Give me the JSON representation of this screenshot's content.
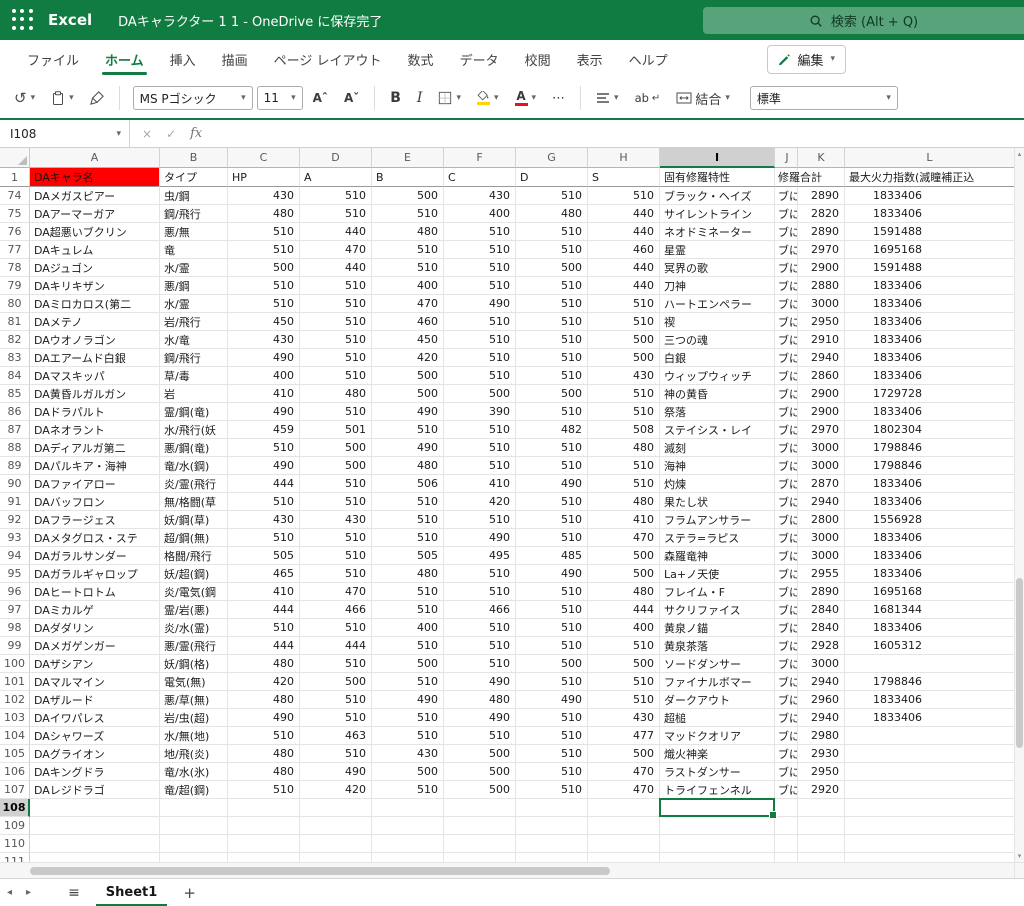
{
  "titlebar": {
    "app": "Excel",
    "title": "DAキャラクター 1 1 - OneDrive に保存完了",
    "search_placeholder": "検索 (Alt + Q)"
  },
  "ribbon": {
    "tabs": [
      "ファイル",
      "ホーム",
      "挿入",
      "描画",
      "ページ レイアウト",
      "数式",
      "データ",
      "校閲",
      "表示",
      "ヘルプ"
    ],
    "active_tab": "ホーム",
    "edit_label": "編集"
  },
  "toolbar": {
    "font_name": "MS Pゴシック",
    "font_size": "11",
    "bold": "B",
    "italic": "I",
    "font_color_a": "A",
    "wrap_text": "ab",
    "merge_label": "結合",
    "number_format": "標準"
  },
  "formula_bar": {
    "name_box": "I108",
    "fx": "fx",
    "value": ""
  },
  "grid": {
    "columns": [
      "A",
      "B",
      "C",
      "D",
      "E",
      "F",
      "G",
      "H",
      "I",
      "J",
      "K",
      "L"
    ],
    "selected": {
      "cell": "I108",
      "column": "I",
      "row": 108
    },
    "header_row": {
      "n": 1,
      "name": "DAキャラ名",
      "type": "タイプ",
      "hp": "HP",
      "a": "A",
      "b": "B",
      "c": "C",
      "d": "D",
      "s": "S",
      "trait": "固有修羅特性",
      "j": "修羅合計",
      "total": "",
      "power": "最大火力指数(滅瞳補正込"
    },
    "rows": [
      {
        "n": 74,
        "name": "DAメガスピアー",
        "type": "虫/鋼",
        "hp": 430,
        "a": 510,
        "b": 500,
        "c": 430,
        "d": 510,
        "s": 510,
        "trait": "ブラック・ヘイズ",
        "j": "ブに",
        "total": 2890,
        "power": "1833406"
      },
      {
        "n": 75,
        "name": "DAアーマーガア",
        "type": "鋼/飛行",
        "hp": 480,
        "a": 510,
        "b": 510,
        "c": 400,
        "d": 480,
        "s": 440,
        "trait": "サイレントライン",
        "j": "ブに",
        "total": 2820,
        "power": "1833406"
      },
      {
        "n": 76,
        "name": "DA超悪いブクリン",
        "type": "悪/無",
        "hp": 510,
        "a": 440,
        "b": 480,
        "c": 510,
        "d": 510,
        "s": 440,
        "trait": "ネオドミネーター",
        "j": "ブに",
        "total": 2890,
        "power": "1591488"
      },
      {
        "n": 77,
        "name": "DAキュレム",
        "type": "竜",
        "hp": 510,
        "a": 470,
        "b": 510,
        "c": 510,
        "d": 510,
        "s": 460,
        "trait": "星霊",
        "j": "ブに",
        "total": 2970,
        "power": "1695168"
      },
      {
        "n": 78,
        "name": "DAジュゴン",
        "type": "水/霊",
        "hp": 500,
        "a": 440,
        "b": 510,
        "c": 510,
        "d": 500,
        "s": 440,
        "trait": "冥界の歌",
        "j": "ブに",
        "total": 2900,
        "power": "1591488"
      },
      {
        "n": 79,
        "name": "DAキリキザン",
        "type": "悪/鋼",
        "hp": 510,
        "a": 510,
        "b": 400,
        "c": 510,
        "d": 510,
        "s": 440,
        "trait": "刀神",
        "j": "ブに",
        "total": 2880,
        "power": "1833406"
      },
      {
        "n": 80,
        "name": "DAミロカロス(第二",
        "type": "水/霊",
        "hp": 510,
        "a": 510,
        "b": 470,
        "c": 490,
        "d": 510,
        "s": 510,
        "trait": "ハートエンペラー",
        "j": "ブに",
        "total": 3000,
        "power": "1833406"
      },
      {
        "n": 81,
        "name": "DAメテノ",
        "type": "岩/飛行",
        "hp": 450,
        "a": 510,
        "b": 460,
        "c": 510,
        "d": 510,
        "s": 510,
        "trait": "禊",
        "j": "ブに",
        "total": 2950,
        "power": "1833406"
      },
      {
        "n": 82,
        "name": "DAウオノラゴン",
        "type": "水/竜",
        "hp": 430,
        "a": 510,
        "b": 450,
        "c": 510,
        "d": 510,
        "s": 500,
        "trait": "三つの魂",
        "j": "ブに",
        "total": 2910,
        "power": "1833406"
      },
      {
        "n": 83,
        "name": "DAエアームド白銀",
        "type": "鋼/飛行",
        "hp": 490,
        "a": 510,
        "b": 420,
        "c": 510,
        "d": 510,
        "s": 500,
        "trait": "白銀",
        "j": "ブに",
        "total": 2940,
        "power": "1833406"
      },
      {
        "n": 84,
        "name": "DAマスキッパ",
        "type": "草/毒",
        "hp": 400,
        "a": 510,
        "b": 500,
        "c": 510,
        "d": 510,
        "s": 430,
        "trait": "ウィップウィッチ",
        "j": "ブに",
        "total": 2860,
        "power": "1833406"
      },
      {
        "n": 85,
        "name": "DA黄昏ルガルガン",
        "type": "岩",
        "hp": 410,
        "a": 480,
        "b": 500,
        "c": 500,
        "d": 500,
        "s": 510,
        "trait": "神の黄昏",
        "j": "ブに",
        "total": 2900,
        "power": "1729728"
      },
      {
        "n": 86,
        "name": "DAドラパルト",
        "type": "霊/鋼(竜)",
        "hp": 490,
        "a": 510,
        "b": 490,
        "c": 390,
        "d": 510,
        "s": 510,
        "trait": "祭落",
        "j": "ブに",
        "total": 2900,
        "power": "1833406"
      },
      {
        "n": 87,
        "name": "DAネオラント",
        "type": "水/飛行(妖",
        "hp": 459,
        "a": 501,
        "b": 510,
        "c": 510,
        "d": 482,
        "s": 508,
        "trait": "ステイシス・レイ",
        "j": "ブに",
        "total": 2970,
        "power": "1802304"
      },
      {
        "n": 88,
        "name": "DAディアルガ第二",
        "type": "悪/鋼(竜)",
        "hp": 510,
        "a": 500,
        "b": 490,
        "c": 510,
        "d": 510,
        "s": 480,
        "trait": "滅刻",
        "j": "ブに",
        "total": 3000,
        "power": "1798846"
      },
      {
        "n": 89,
        "name": "DAパルキア・海神",
        "type": "竜/水(鋼)",
        "hp": 490,
        "a": 500,
        "b": 480,
        "c": 510,
        "d": 510,
        "s": 510,
        "trait": "海神",
        "j": "ブに",
        "total": 3000,
        "power": "1798846"
      },
      {
        "n": 90,
        "name": "DAファイアロー",
        "type": "炎/霊(飛行",
        "hp": 444,
        "a": 510,
        "b": 506,
        "c": 410,
        "d": 490,
        "s": 510,
        "trait": "灼煉",
        "j": "ブに",
        "total": 2870,
        "power": "1833406"
      },
      {
        "n": 91,
        "name": "DAバッフロン",
        "type": "無/格闘(草",
        "hp": 510,
        "a": 510,
        "b": 510,
        "c": 420,
        "d": 510,
        "s": 480,
        "trait": "果たし状",
        "j": "ブに",
        "total": 2940,
        "power": "1833406"
      },
      {
        "n": 92,
        "name": "DAフラージェス",
        "type": "妖/鋼(草)",
        "hp": 430,
        "a": 430,
        "b": 510,
        "c": 510,
        "d": 510,
        "s": 410,
        "trait": "フラムアンサラー",
        "j": "ブに",
        "total": 2800,
        "power": "1556928"
      },
      {
        "n": 93,
        "name": "DAメタグロス・ステ",
        "type": "超/鋼(無)",
        "hp": 510,
        "a": 510,
        "b": 510,
        "c": 490,
        "d": 510,
        "s": 470,
        "trait": "ステラ=ラピス",
        "j": "ブに",
        "total": 3000,
        "power": "1833406"
      },
      {
        "n": 94,
        "name": "DAガラルサンダー",
        "type": "格闘/飛行",
        "hp": 505,
        "a": 510,
        "b": 505,
        "c": 495,
        "d": 485,
        "s": 500,
        "trait": "森羅竜神",
        "j": "ブに",
        "total": 3000,
        "power": "1833406"
      },
      {
        "n": 95,
        "name": "DAガラルギャロップ",
        "type": "妖/超(鋼)",
        "hp": 465,
        "a": 510,
        "b": 480,
        "c": 510,
        "d": 490,
        "s": 500,
        "trait": "La+ノ天使",
        "j": "ブに",
        "total": 2955,
        "power": "1833406"
      },
      {
        "n": 96,
        "name": "DAヒートロトム",
        "type": "炎/電気(鋼",
        "hp": 410,
        "a": 470,
        "b": 510,
        "c": 510,
        "d": 510,
        "s": 480,
        "trait": "フレイム・F",
        "j": "ブに",
        "total": 2890,
        "power": "1695168"
      },
      {
        "n": 97,
        "name": "DAミカルゲ",
        "type": "霊/岩(悪)",
        "hp": 444,
        "a": 466,
        "b": 510,
        "c": 466,
        "d": 510,
        "s": 444,
        "trait": "サクリファイス",
        "j": "ブに",
        "total": 2840,
        "power": "1681344"
      },
      {
        "n": 98,
        "name": "DAダダリン",
        "type": "炎/水(霊)",
        "hp": 510,
        "a": 510,
        "b": 400,
        "c": 510,
        "d": 510,
        "s": 400,
        "trait": "黄泉ノ錨",
        "j": "ブに",
        "total": 2840,
        "power": "1833406"
      },
      {
        "n": 99,
        "name": "DAメガゲンガー",
        "type": "悪/霊(飛行",
        "hp": 444,
        "a": 444,
        "b": 510,
        "c": 510,
        "d": 510,
        "s": 510,
        "trait": "黄泉茶落",
        "j": "ブに",
        "total": 2928,
        "power": "1605312"
      },
      {
        "n": 100,
        "name": "DAザシアン",
        "type": "妖/鋼(格)",
        "hp": 480,
        "a": 510,
        "b": 500,
        "c": 510,
        "d": 500,
        "s": 500,
        "trait": "ソードダンサー",
        "j": "ブに",
        "total": 3000,
        "power": ""
      },
      {
        "n": 101,
        "name": "DAマルマイン",
        "type": "電気(無)",
        "hp": 420,
        "a": 500,
        "b": 510,
        "c": 490,
        "d": 510,
        "s": 510,
        "trait": "ファイナルボマー",
        "j": "ブに",
        "total": 2940,
        "power": "1798846"
      },
      {
        "n": 102,
        "name": "DAザルード",
        "type": "悪/草(無)",
        "hp": 480,
        "a": 510,
        "b": 490,
        "c": 480,
        "d": 490,
        "s": 510,
        "trait": "ダークアウト",
        "j": "ブに",
        "total": 2960,
        "power": "1833406"
      },
      {
        "n": 103,
        "name": "DAイワパレス",
        "type": "岩/虫(超)",
        "hp": 490,
        "a": 510,
        "b": 510,
        "c": 490,
        "d": 510,
        "s": 430,
        "trait": "超槌",
        "j": "ブに",
        "total": 2940,
        "power": "1833406"
      },
      {
        "n": 104,
        "name": "DAシャワーズ",
        "type": "水/無(地)",
        "hp": 510,
        "a": 463,
        "b": 510,
        "c": 510,
        "d": 510,
        "s": 477,
        "trait": "マッドクオリア",
        "j": "ブに",
        "total": 2980,
        "power": ""
      },
      {
        "n": 105,
        "name": "DAグライオン",
        "type": "地/飛(炎)",
        "hp": 480,
        "a": 510,
        "b": 430,
        "c": 500,
        "d": 510,
        "s": 500,
        "trait": "熾火神楽",
        "j": "ブに",
        "total": 2930,
        "power": ""
      },
      {
        "n": 106,
        "name": "DAキングドラ",
        "type": "竜/水(氷)",
        "hp": 480,
        "a": 490,
        "b": 500,
        "c": 500,
        "d": 510,
        "s": 470,
        "trait": "ラストダンサー",
        "j": "ブに",
        "total": 2950,
        "power": ""
      },
      {
        "n": 107,
        "name": "DAレジドラゴ",
        "type": "竜/超(鋼)",
        "hp": 510,
        "a": 420,
        "b": 510,
        "c": 500,
        "d": 510,
        "s": 470,
        "trait": "トライフェンネル",
        "j": "ブに",
        "total": 2920,
        "power": ""
      }
    ],
    "empty_rows": [
      108,
      109,
      110,
      111
    ]
  },
  "sheetbar": {
    "sheet": "Sheet1"
  },
  "icons": {
    "chevron": "▾",
    "undo": "↺",
    "more": "⋯",
    "wrap_return": "↵",
    "close": "×",
    "check": "✓",
    "font_grow": "Aˆ",
    "font_shrink": "Aˇ",
    "prev": "◂",
    "next": "▸",
    "add": "+",
    "sheet_list": "≡",
    "scroll_up": "▴",
    "scroll_down": "▾"
  },
  "colors": {
    "accent_green": "#107c41",
    "cell_red": "#ff0000",
    "font_color_red": "#e81123",
    "fill_color_yellow": "#ffd400"
  }
}
